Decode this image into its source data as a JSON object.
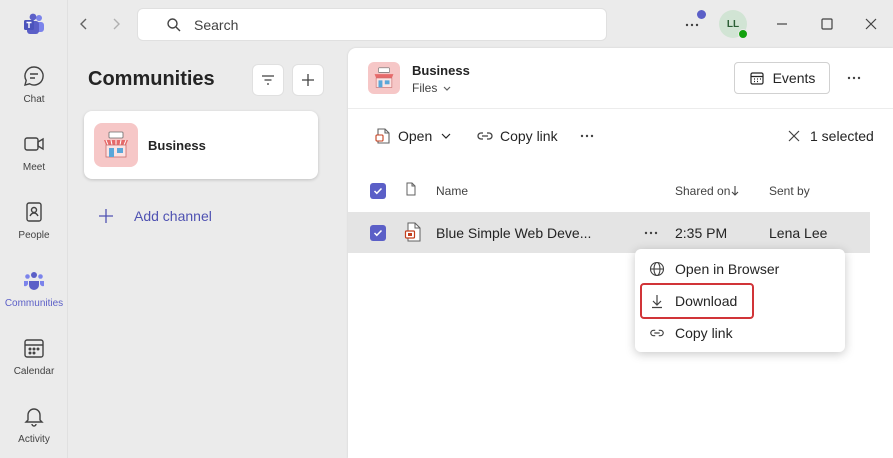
{
  "rail": {
    "items": [
      {
        "label": "Chat",
        "icon": "chat-icon"
      },
      {
        "label": "Meet",
        "icon": "video-icon"
      },
      {
        "label": "People",
        "icon": "people-icon"
      },
      {
        "label": "Communities",
        "icon": "communities-icon"
      },
      {
        "label": "Calendar",
        "icon": "calendar-icon"
      },
      {
        "label": "Activity",
        "icon": "bell-icon"
      }
    ]
  },
  "titlebar": {
    "search_placeholder": "Search",
    "avatar_initials": "LL"
  },
  "communities": {
    "title": "Communities",
    "card_name": "Business",
    "add_channel": "Add channel"
  },
  "main": {
    "title": "Business",
    "subtitle": "Files",
    "events_label": "Events",
    "toolbar": {
      "open": "Open",
      "copy_link": "Copy link",
      "selected": "1 selected"
    },
    "columns": {
      "name": "Name",
      "shared_on": "Shared on",
      "sent_by": "Sent by"
    },
    "file": {
      "name": "Blue Simple Web Deve...",
      "time": "2:35 PM",
      "sender": "Lena Lee"
    }
  },
  "context_menu": {
    "items": [
      "Open in Browser",
      "Download",
      "Copy link"
    ]
  },
  "colors": {
    "accent": "#5b5fc7",
    "highlight": "#d13438"
  }
}
